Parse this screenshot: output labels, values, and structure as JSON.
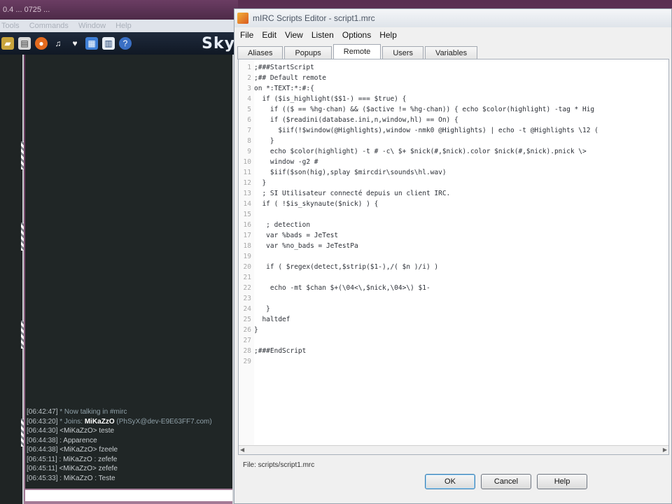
{
  "main_window": {
    "title": "0.4 ... 0725 ... ",
    "menu": [
      "Tools",
      "Commands",
      "Window",
      "Help"
    ],
    "toolbar_icons": [
      "folder-icon",
      "document-icon",
      "firefox-icon",
      "music-note-icon",
      "fox-icon",
      "grid-icon",
      "list-icon",
      "info-icon"
    ],
    "brand": "Sky",
    "chat": [
      {
        "time": "06:42:47",
        "text": " * Now talking in #mirc",
        "kind": "sys"
      },
      {
        "time": "06:43:20",
        "text": " * Joins: ",
        "nick": "MiKaZzO",
        "tail": " (PhSyX@dev-E9E63FF7.com)",
        "kind": "sys"
      },
      {
        "time": "06:44:30",
        "text": " <MiKaZzO> teste",
        "kind": "msg"
      },
      {
        "time": "06:44:38",
        "text": " : Apparence",
        "kind": "msg"
      },
      {
        "time": "06:44:38",
        "text": " <MiKaZzO> fzeele",
        "kind": "msg"
      },
      {
        "time": "06:45:11",
        "text": " : MiKaZzO : zefefe",
        "kind": "msg"
      },
      {
        "time": "06:45:11",
        "text": " <MiKaZzO> zefefe",
        "kind": "msg"
      },
      {
        "time": "06:45:33",
        "text": " : MiKaZzO : Teste",
        "kind": "msg"
      }
    ]
  },
  "editor": {
    "title": "mIRC Scripts Editor - script1.mrc",
    "menu": [
      "File",
      "Edit",
      "View",
      "Listen",
      "Options",
      "Help"
    ],
    "tabs": [
      "Aliases",
      "Popups",
      "Remote",
      "Users",
      "Variables"
    ],
    "active_tab": "Remote",
    "lines": [
      ";###StartScript",
      ";## Default remote",
      "on *:TEXT:*:#:{",
      "  if ($is_highlight($$1-) === $true) {",
      "    if (($ == %hg-chan) && ($active != %hg-chan)) { echo $color(highlight) -tag * Hig",
      "    if ($readini(database.ini,n,window,hl) == On) {",
      "      $iif(!$window(@Highlights),window -nmk0 @Highlights) | echo -t @Highlights \\12 (",
      "    }",
      "    echo $color(highlight) -t # -c\\ $+ $nick(#,$nick).color $nick(#,$nick).pnick \\>",
      "    window -g2 #",
      "    $iif($son(hig),splay $mircdir\\sounds\\hl.wav)",
      "  }",
      "  ; SI Utilisateur connecté depuis un client IRC.",
      "  if ( !$is_skynaute($nick) ) {",
      "",
      "   ; detection",
      "   var %bads = JeTest",
      "   var %no_bads = JeTestPa",
      "",
      "   if ( $regex(detect,$strip($1-),/( $n )/i) )",
      "",
      "    echo -mt $chan $+(\\04<\\,$nick,\\04>\\) $1-",
      "",
      "   }",
      "  haltdef",
      "}",
      "",
      ";###EndScript",
      ""
    ],
    "file_label": "File: scripts/script1.mrc",
    "buttons": {
      "ok": "OK",
      "cancel": "Cancel",
      "help": "Help"
    }
  }
}
